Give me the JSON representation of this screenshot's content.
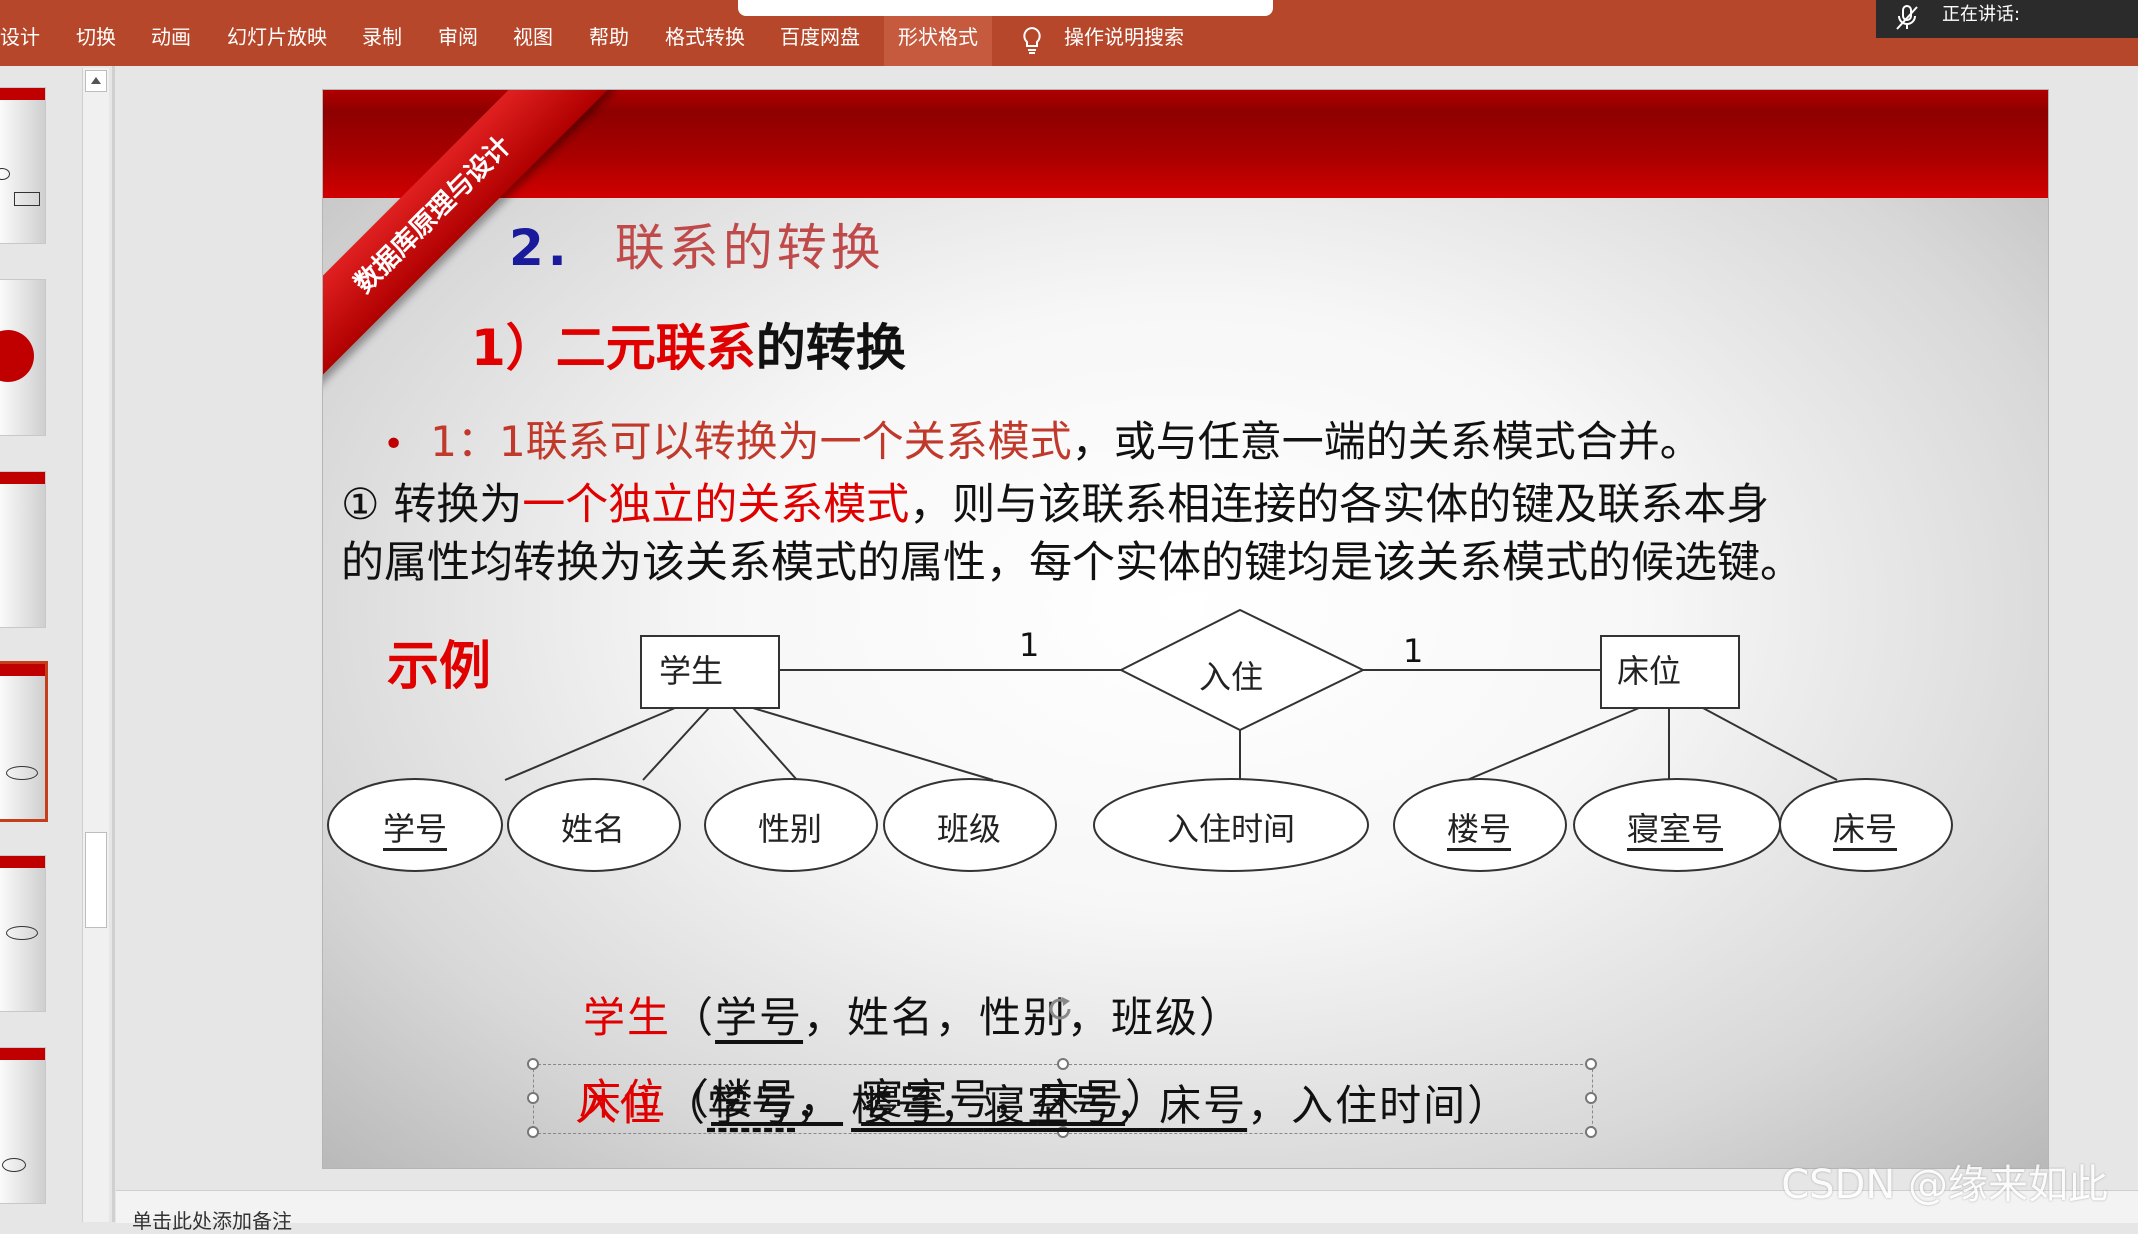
{
  "ribbon": {
    "tabs": [
      "设计",
      "切换",
      "动画",
      "幻灯片放映",
      "录制",
      "审阅",
      "视图",
      "帮助",
      "格式转换",
      "百度网盘",
      "形状格式"
    ],
    "active_tab": "形状格式",
    "tell_me": "操作说明搜索",
    "speaking": "正在讲话:"
  },
  "notes_placeholder": "单击此处添加备注",
  "slide": {
    "corner_ribbon": "数据库原理与设计",
    "title_num": "2.",
    "title_text": "联系的转换",
    "sub_red": "1）二元联系",
    "sub_black": "的转换",
    "bullet_red": "1：1联系可以转换为一个关系模式",
    "bullet_black": "，或与任意一端的关系模式合并。",
    "para_1a": "① 转换为",
    "para_1b": "一个独立的关系模式",
    "para_1c": "，则与该联系相连接的各实体的键及联系本身",
    "para_2": "的属性均转换为该关系模式的属性，每个实体的键均是该关系模式的候选键。",
    "example": "示例",
    "er": {
      "entity_left": "学生",
      "entity_right": "床位",
      "relationship": "入住",
      "card_left": "1",
      "card_right": "1",
      "attributes": [
        "学号",
        "姓名",
        "性别",
        "班级",
        "入住时间",
        "楼号",
        "寝室号",
        "床号"
      ]
    },
    "schemas": {
      "s1_name": "学生",
      "s1_open": "（",
      "s1_pk": "学号",
      "s1_rest": "，姓名，性别，班级）",
      "s2_name": "床位",
      "s2_open": "（",
      "s2_pk1": "楼号，",
      "s2_pk2": "寝室号，",
      "s2_pk3": "床号",
      "s2_close": "）",
      "s3_name": "入住",
      "s3_open": "（",
      "s3_k1": "学号",
      "s3_sep": "，",
      "s3_k2": "楼号，",
      "s3_k3": "寝室号，",
      "s3_k4": "床号",
      "s3_rest": "，入住时间）"
    }
  },
  "watermark": "CSDN @缘来如此",
  "colors": {
    "ribbon": "#b7472a",
    "accent_red": "#e00000",
    "slide_band": "#a80000"
  }
}
